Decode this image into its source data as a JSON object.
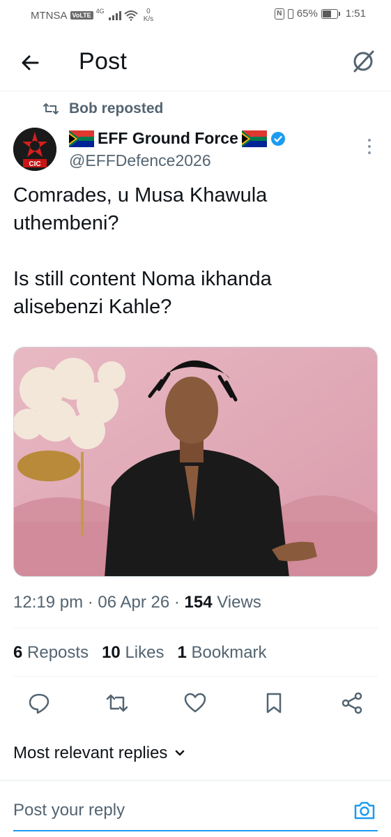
{
  "status_bar": {
    "carrier": "MTNSA",
    "volte": "VoLTE",
    "network": "4G",
    "speed_value": "0",
    "speed_unit": "K/s",
    "battery": "65%",
    "battery_level": 0.65,
    "time": "1:51"
  },
  "header": {
    "title": "Post"
  },
  "post": {
    "repost_label": "Bob reposted",
    "author_name": "EFF Ground Force",
    "author_handle": "@EFFDefence2026",
    "avatar_text": "CIC",
    "text": "Comrades, u Musa Khawula\nuthembeni?\n\nIs still content Noma ikhanda\nalisebenzi Kahle?",
    "time": "12:19 pm",
    "date": "06 Apr 26",
    "views_count": "154",
    "views_label": "Views",
    "reposts_count": "6",
    "reposts_label": "Reposts",
    "likes_count": "10",
    "likes_label": "Likes",
    "bookmarks_count": "1",
    "bookmarks_label": "Bookmark"
  },
  "replies": {
    "sort_label": "Most relevant replies",
    "input_placeholder": "Post your reply"
  },
  "icons": {
    "back": "arrow-left-icon",
    "grok": "grok-icon",
    "repost": "repost-icon",
    "verified": "verified-badge-icon",
    "more": "more-vertical-icon",
    "reply": "reply-icon",
    "like": "heart-icon",
    "bookmark": "bookmark-icon",
    "share": "share-icon",
    "camera": "camera-icon"
  },
  "colors": {
    "accent": "#1d9bf0",
    "text_primary": "#0f1419",
    "text_secondary": "#536471"
  }
}
